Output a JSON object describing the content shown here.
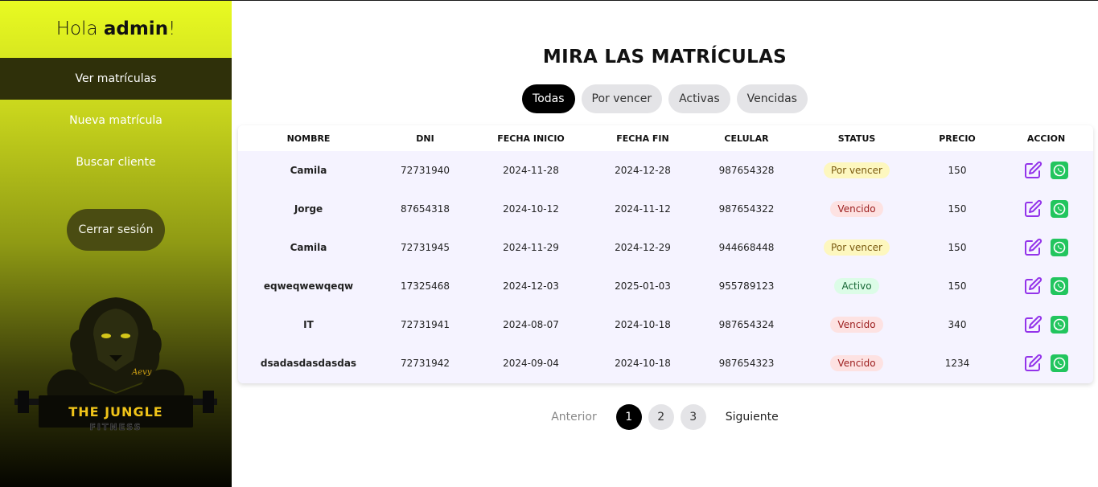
{
  "sidebar": {
    "greeting_prefix": "Hola ",
    "greeting_user": "admin",
    "greeting_suffix": "!",
    "items": [
      {
        "label": "Ver matrículas",
        "active": true
      },
      {
        "label": "Nueva matrícula",
        "active": false
      },
      {
        "label": "Buscar cliente",
        "active": false
      }
    ],
    "logout_label": "Cerrar sesión",
    "logo": {
      "title": "THE JUNGLE",
      "subtitle": "FITNESS"
    }
  },
  "main": {
    "title": "MIRA LAS MATRÍCULAS",
    "filters": [
      {
        "label": "Todas",
        "active": true
      },
      {
        "label": "Por vencer",
        "active": false
      },
      {
        "label": "Activas",
        "active": false
      },
      {
        "label": "Vencidas",
        "active": false
      }
    ],
    "table": {
      "headers": [
        "NOMBRE",
        "DNI",
        "FECHA INICIO",
        "FECHA FIN",
        "CELULAR",
        "STATUS",
        "PRECIO",
        "ACCION"
      ],
      "rows": [
        {
          "nombre": "Camila",
          "dni": "72731940",
          "inicio": "2024-11-28",
          "fin": "2024-12-28",
          "celular": "987654328",
          "status": "Por vencer",
          "precio": "150"
        },
        {
          "nombre": "Jorge",
          "dni": "87654318",
          "inicio": "2024-10-12",
          "fin": "2024-11-12",
          "celular": "987654322",
          "status": "Vencido",
          "precio": "150"
        },
        {
          "nombre": "Camila",
          "dni": "72731945",
          "inicio": "2024-11-29",
          "fin": "2024-12-29",
          "celular": "944668448",
          "status": "Por vencer",
          "precio": "150"
        },
        {
          "nombre": "eqweqwewqeqw",
          "dni": "17325468",
          "inicio": "2024-12-03",
          "fin": "2025-01-03",
          "celular": "955789123",
          "status": "Activo",
          "precio": "150"
        },
        {
          "nombre": "IT",
          "dni": "72731941",
          "inicio": "2024-08-07",
          "fin": "2024-10-18",
          "celular": "987654324",
          "status": "Vencido",
          "precio": "340"
        },
        {
          "nombre": "dsadasdasdasdas",
          "dni": "72731942",
          "inicio": "2024-09-04",
          "fin": "2024-10-18",
          "celular": "987654323",
          "status": "Vencido",
          "precio": "1234"
        }
      ],
      "action_icons": [
        "edit-icon",
        "whatsapp-icon"
      ]
    },
    "pagination": {
      "prev_label": "Anterior",
      "next_label": "Siguiente",
      "pages": [
        "1",
        "2",
        "3"
      ],
      "current": "1"
    }
  },
  "colors": {
    "sidebar_top": "#e9fb22",
    "sidebar_bottom": "#050500",
    "active_nav": "#2f300a",
    "edit_icon": "#9333ea",
    "whatsapp_icon": "#22c55e",
    "status_por_vencer_bg": "#fdf7bf",
    "status_vencido_bg": "#fde2e2",
    "status_activo_bg": "#dcfce7"
  }
}
